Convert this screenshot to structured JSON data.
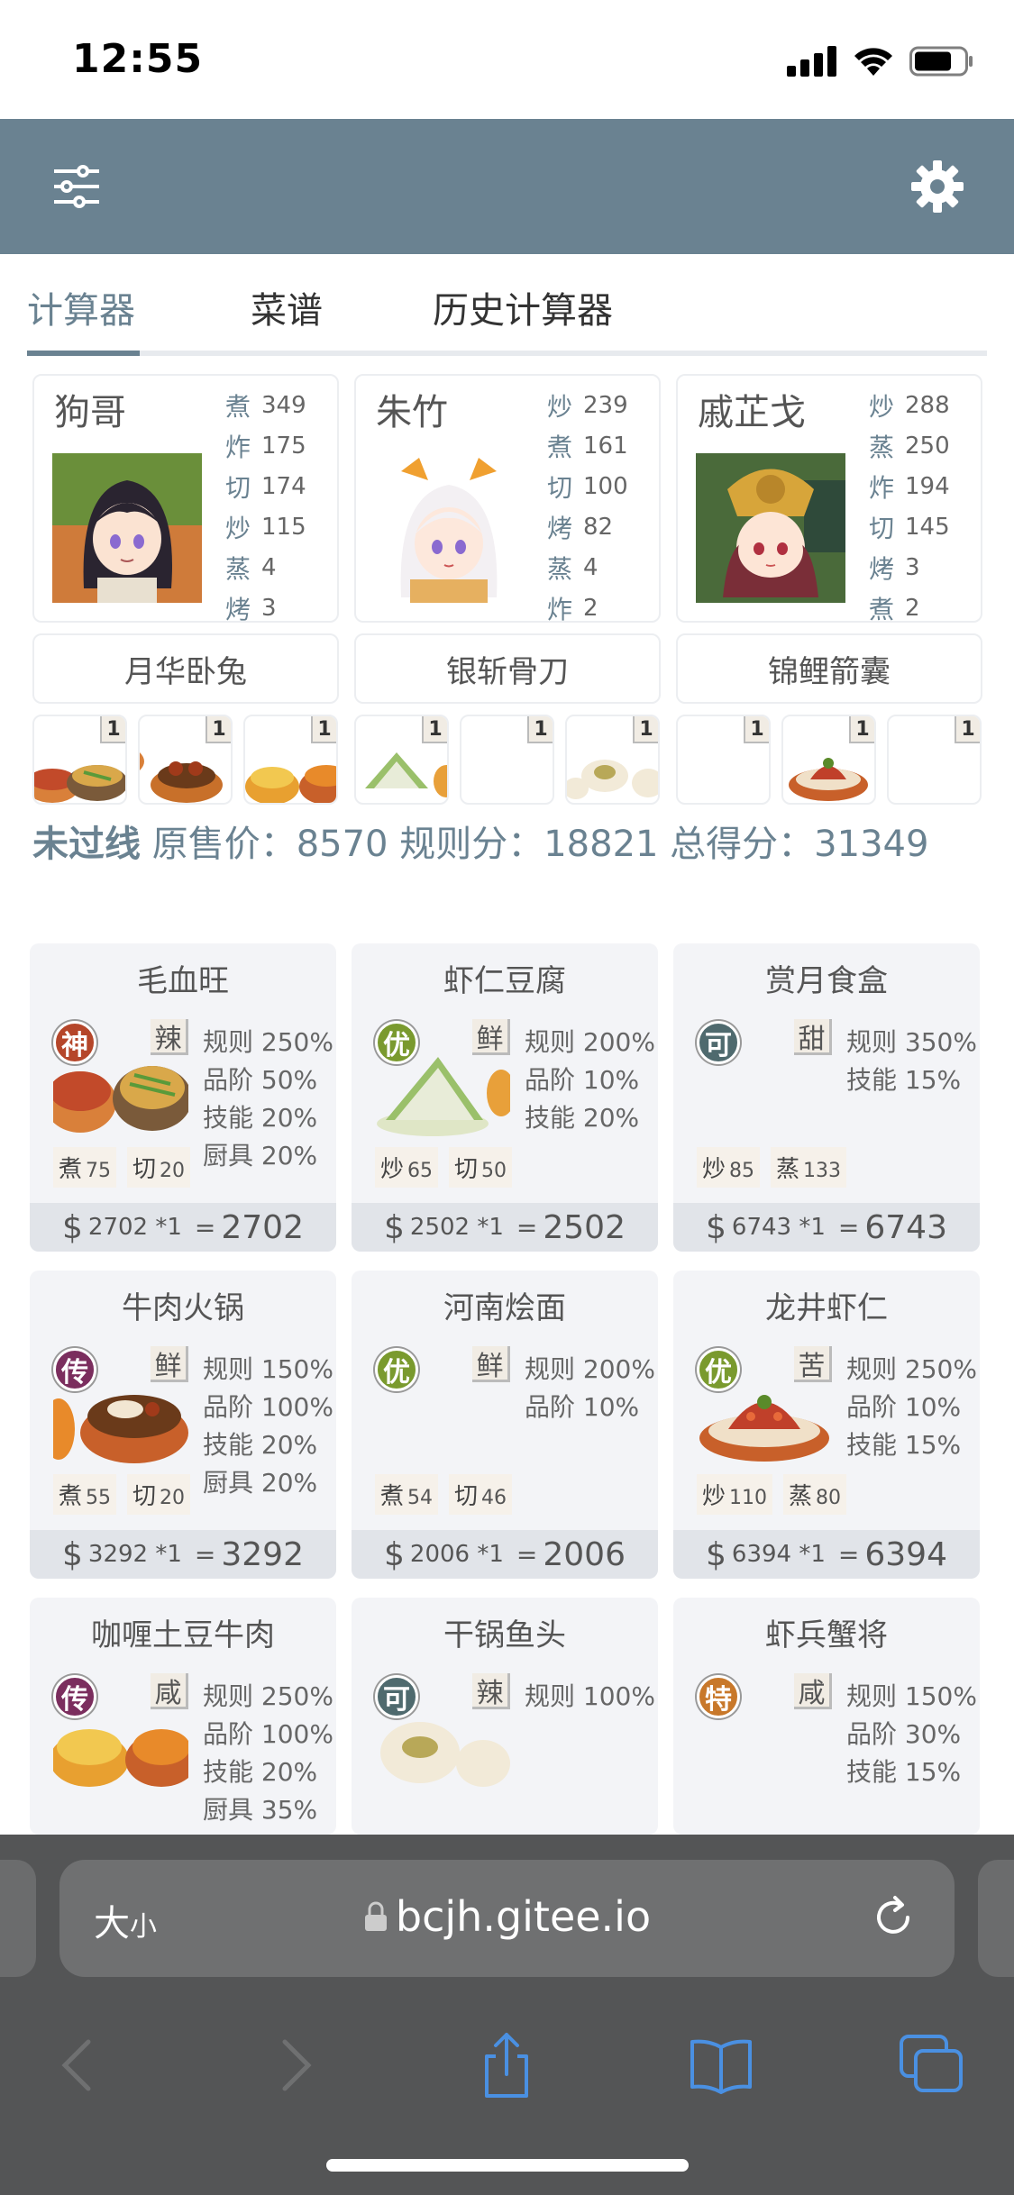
{
  "status": {
    "time": "12:55"
  },
  "tabs": [
    {
      "label": "计算器",
      "active": true
    },
    {
      "label": "菜谱",
      "active": false
    },
    {
      "label": "历史计算器",
      "active": false
    }
  ],
  "chefs": [
    {
      "name": "狗哥",
      "skills": [
        {
          "n": "煮",
          "v": "349"
        },
        {
          "n": "炸",
          "v": "175"
        },
        {
          "n": "切",
          "v": "174"
        },
        {
          "n": "炒",
          "v": "115"
        },
        {
          "n": "蒸",
          "v": "4"
        },
        {
          "n": "烤",
          "v": "3"
        }
      ],
      "equip": "月华卧兔"
    },
    {
      "name": "朱竹",
      "skills": [
        {
          "n": "炒",
          "v": "239"
        },
        {
          "n": "煮",
          "v": "161"
        },
        {
          "n": "切",
          "v": "100"
        },
        {
          "n": "烤",
          "v": "82"
        },
        {
          "n": "蒸",
          "v": "4"
        },
        {
          "n": "炸",
          "v": "2"
        }
      ],
      "equip": "银斩骨刀"
    },
    {
      "name": "戚芷戈",
      "skills": [
        {
          "n": "炒",
          "v": "288"
        },
        {
          "n": "蒸",
          "v": "250"
        },
        {
          "n": "炸",
          "v": "194"
        },
        {
          "n": "切",
          "v": "145"
        },
        {
          "n": "烤",
          "v": "3"
        },
        {
          "n": "煮",
          "v": "2"
        }
      ],
      "equip": "锦鲤箭囊"
    }
  ],
  "slots": [
    {
      "q": "1"
    },
    {
      "q": "1"
    },
    {
      "q": "1"
    },
    {
      "q": "1"
    },
    {
      "q": "1"
    },
    {
      "q": "1"
    },
    {
      "q": "1"
    },
    {
      "q": "1"
    },
    {
      "q": "1"
    }
  ],
  "summary": {
    "status": "未过线",
    "text": " 原售价：8570 规则分：18821 总得分：31349"
  },
  "recipes": [
    {
      "name": "毛血旺",
      "rarity": "神",
      "rarity_color": "#b5462a",
      "flavor": "辣",
      "bonuses": [
        "规则 250%",
        "品阶 50%",
        "技能 20%",
        "厨具 20%"
      ],
      "conds": [
        {
          "s": "煮",
          "v": "75"
        },
        {
          "s": "切",
          "v": "20"
        }
      ],
      "base": "2702 *1",
      "total": "2702"
    },
    {
      "name": "虾仁豆腐",
      "rarity": "优",
      "rarity_color": "#7a9a2e",
      "flavor": "鲜",
      "bonuses": [
        "规则 200%",
        "品阶 10%",
        "技能 20%"
      ],
      "conds": [
        {
          "s": "炒",
          "v": "65"
        },
        {
          "s": "切",
          "v": "50"
        }
      ],
      "base": "2502 *1",
      "total": "2502"
    },
    {
      "name": "赏月食盒",
      "rarity": "可",
      "rarity_color": "#4f6a6e",
      "flavor": "甜",
      "bonuses": [
        "规则 350%",
        "技能 15%"
      ],
      "conds": [
        {
          "s": "炒",
          "v": "85"
        },
        {
          "s": "蒸",
          "v": "133"
        }
      ],
      "base": "6743 *1",
      "total": "6743"
    },
    {
      "name": "牛肉火锅",
      "rarity": "传",
      "rarity_color": "#7b2e5e",
      "flavor": "鲜",
      "bonuses": [
        "规则 150%",
        "品阶 100%",
        "技能 20%",
        "厨具 20%"
      ],
      "conds": [
        {
          "s": "煮",
          "v": "55"
        },
        {
          "s": "切",
          "v": "20"
        }
      ],
      "base": "3292 *1",
      "total": "3292"
    },
    {
      "name": "河南烩面",
      "rarity": "优",
      "rarity_color": "#7a9a2e",
      "flavor": "鲜",
      "bonuses": [
        "规则 200%",
        "品阶 10%"
      ],
      "conds": [
        {
          "s": "煮",
          "v": "54"
        },
        {
          "s": "切",
          "v": "46"
        }
      ],
      "base": "2006 *1",
      "total": "2006"
    },
    {
      "name": "龙井虾仁",
      "rarity": "优",
      "rarity_color": "#7a9a2e",
      "flavor": "苦",
      "bonuses": [
        "规则 250%",
        "品阶 10%",
        "技能 15%"
      ],
      "conds": [
        {
          "s": "炒",
          "v": "110"
        },
        {
          "s": "蒸",
          "v": "80"
        }
      ],
      "base": "6394 *1",
      "total": "6394"
    },
    {
      "name": "咖喱土豆牛肉",
      "rarity": "传",
      "rarity_color": "#7b2e5e",
      "flavor": "咸",
      "bonuses": [
        "规则 250%",
        "品阶 100%",
        "技能 20%",
        "厨具 35%"
      ],
      "conds": [],
      "base": "",
      "total": ""
    },
    {
      "name": "干锅鱼头",
      "rarity": "可",
      "rarity_color": "#4f6a6e",
      "flavor": "辣",
      "bonuses": [
        "规则 100%"
      ],
      "conds": [],
      "base": "",
      "total": ""
    },
    {
      "name": "虾兵蟹将",
      "rarity": "特",
      "rarity_color": "#c8782a",
      "flavor": "咸",
      "bonuses": [
        "规则 150%",
        "品阶 30%",
        "技能 15%"
      ],
      "conds": [],
      "base": "",
      "total": ""
    }
  ],
  "currency": "$",
  "browser": {
    "text_size_label": "大",
    "text_size_small": "小",
    "url": "bcjh.gitee.io"
  },
  "icons": {
    "menu": "sliders-icon",
    "settings": "gear-icon",
    "reload": "reload-icon",
    "back": "back-icon",
    "forward": "forward-icon",
    "share": "share-icon",
    "bookmarks": "bookmarks-icon",
    "tabs": "tabs-icon"
  }
}
